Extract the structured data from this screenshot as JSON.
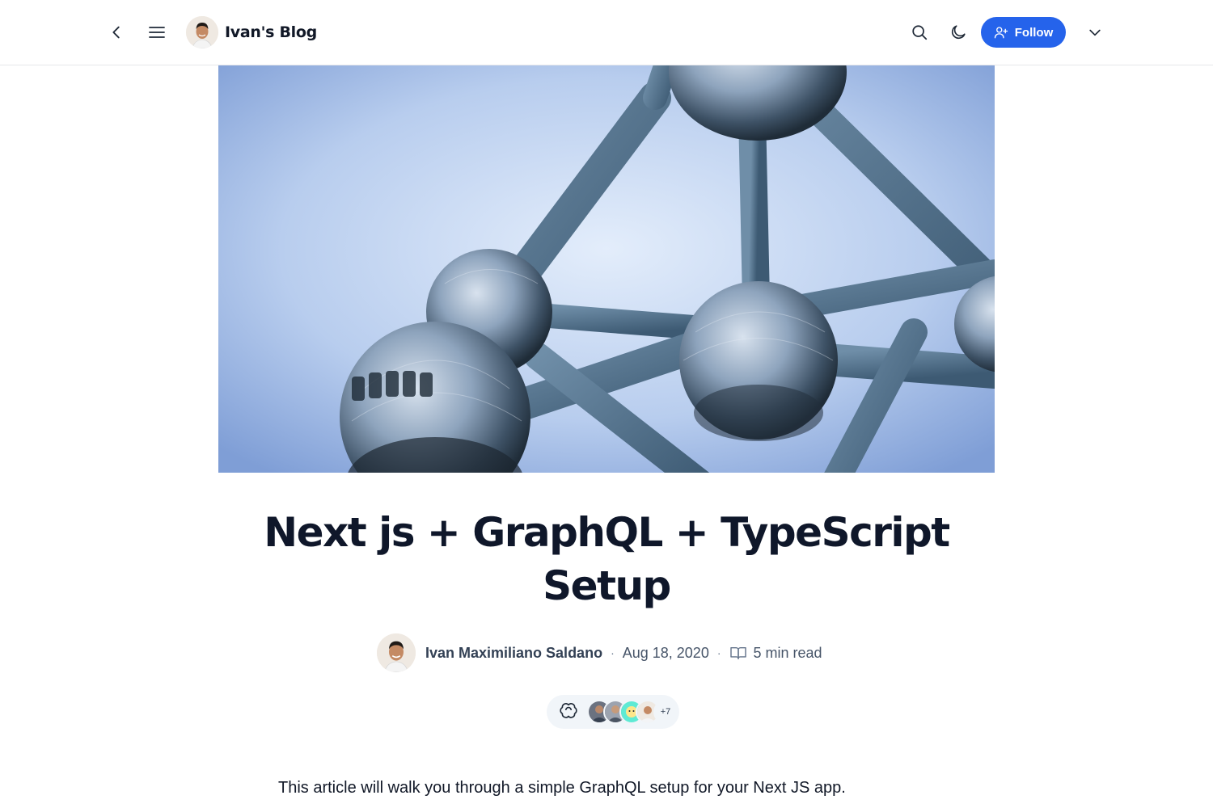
{
  "header": {
    "brand_title": "Ivan's Blog",
    "follow_label": "Follow",
    "icons": [
      "chevron-left-icon",
      "hamburger-menu-icon",
      "search-icon",
      "moon-icon",
      "user-plus-icon",
      "chevron-down-icon"
    ]
  },
  "article": {
    "title": "Next js + GraphQL + TypeScript Setup",
    "author": "Ivan Maximiliano Saldano",
    "separator": "·",
    "date": "Aug 18, 2020",
    "read_time": "5 min read",
    "reactions_more": "+7",
    "intro": "This article will walk you through a simple GraphQL setup for your Next JS app."
  },
  "colors": {
    "accent": "#2563eb",
    "title_text": "#0f172a",
    "meta_text": "#475569",
    "border": "#e5e7eb",
    "pill_bg": "#f1f5f9"
  }
}
